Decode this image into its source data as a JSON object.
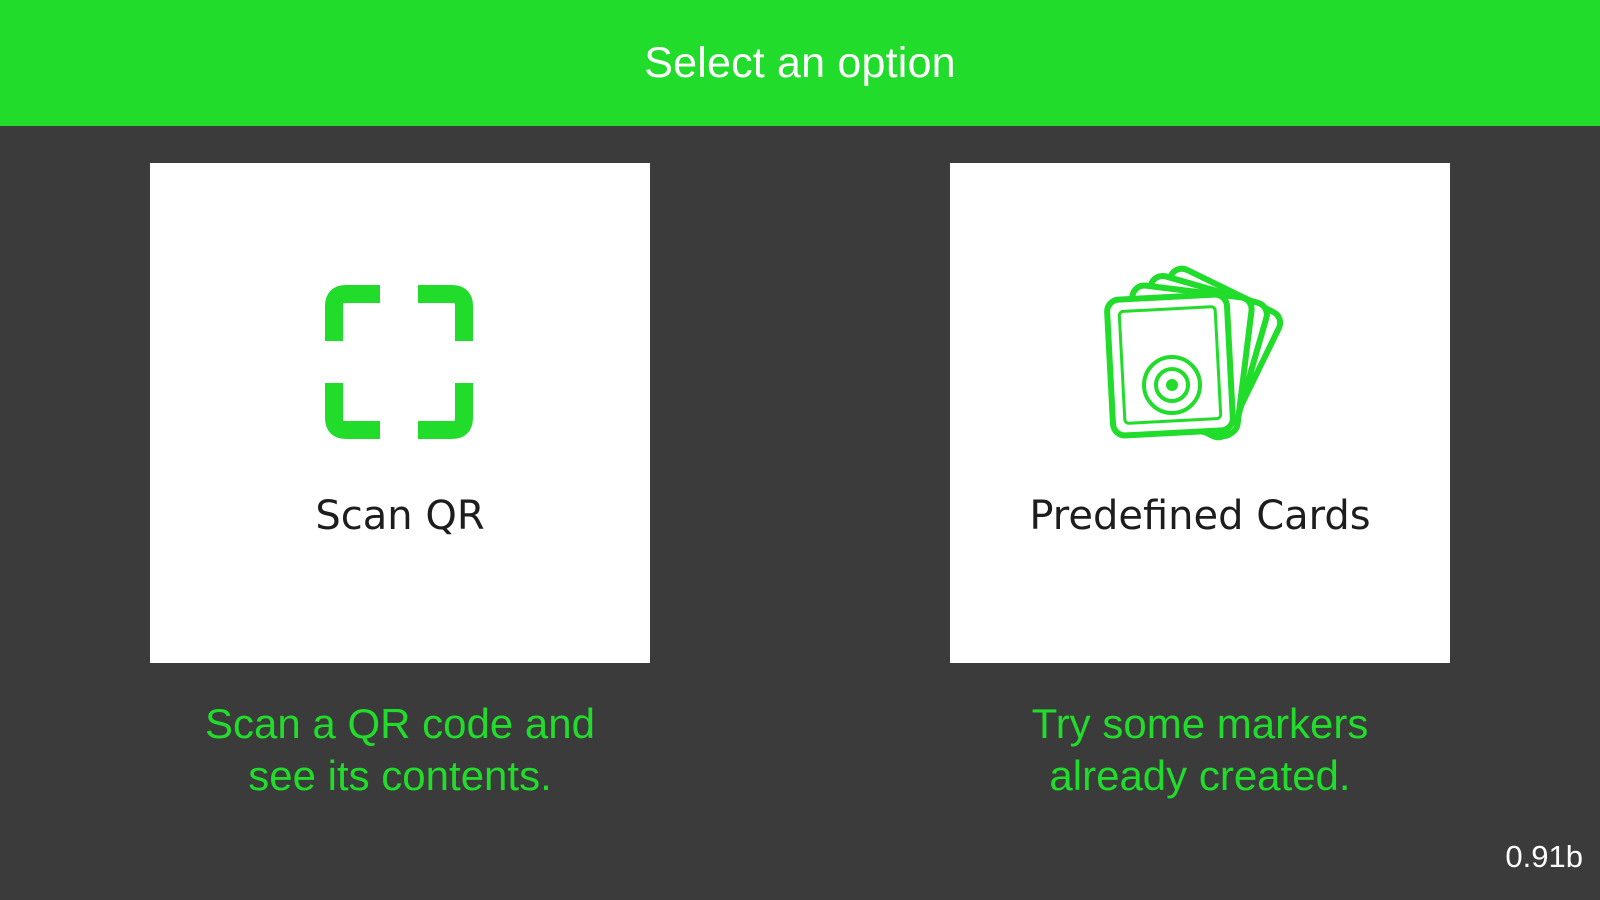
{
  "header": {
    "title": "Select an option"
  },
  "options": [
    {
      "label": "Scan QR",
      "icon": "qr-scan-icon",
      "description_lines": [
        "Scan a QR code and",
        "see its contents."
      ]
    },
    {
      "label": "Predefined Cards",
      "icon": "marker-cards-icon",
      "description_lines": [
        "Try some markers",
        "already created."
      ]
    }
  ],
  "version": "0.91b",
  "colors": {
    "accent": "#21dc2b",
    "background": "#3b3b3b",
    "card": "#ffffff",
    "label_text": "#1d1d1d",
    "header_text": "#ffffff"
  }
}
